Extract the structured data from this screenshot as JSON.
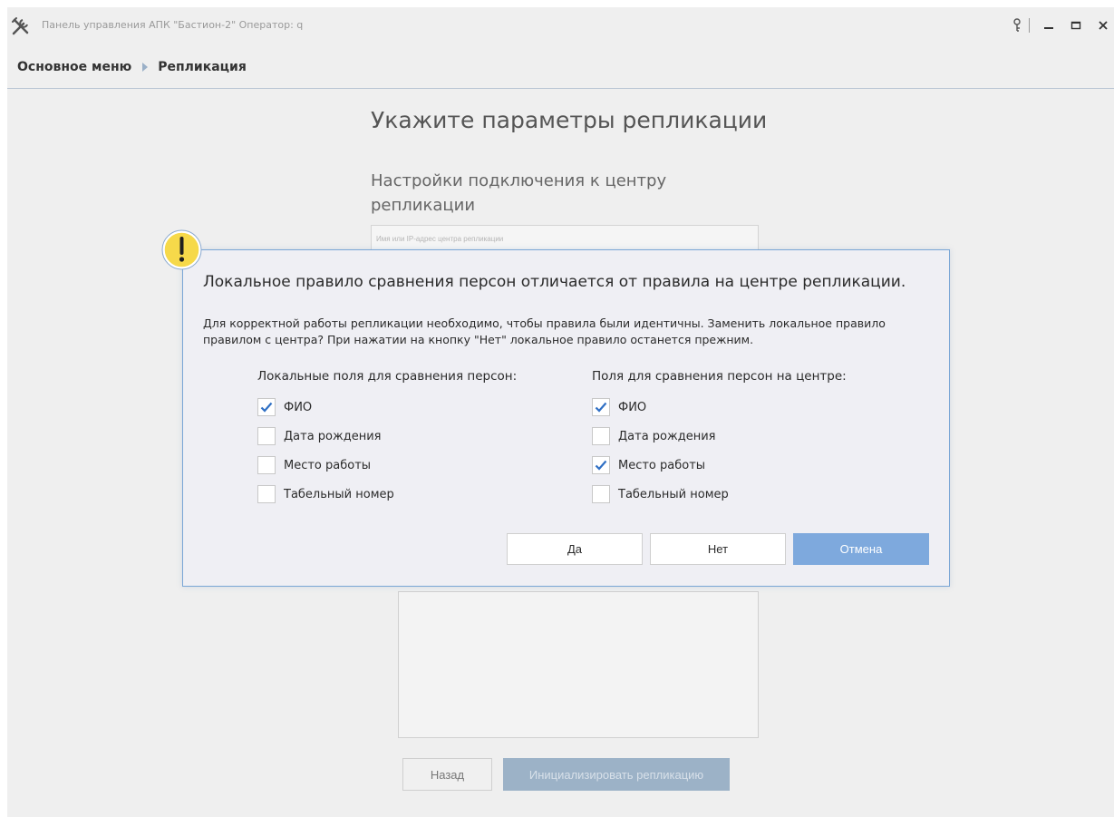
{
  "window": {
    "title": "Панель управления АПК \"Бастион-2\"  Оператор: q",
    "icon": "tools-icon"
  },
  "breadcrumb": {
    "root": "Основное меню",
    "current": "Репликация"
  },
  "page": {
    "title": "Укажите параметры репликации",
    "section_title": "Настройки подключения к центру репликации",
    "server_placeholder": "Имя или IP-адрес центра репликации",
    "back_button": "Назад",
    "init_button": "Инициализировать репликацию"
  },
  "dialog": {
    "icon": "warning-icon",
    "title": "Локальное правило сравнения персон отличается от правила на центре репликации.",
    "message": "Для корректной работы репликации необходимо, чтобы правила были идентичны. Заменить локальное правило правилом с центра? При нажатии на кнопку \"Нет\" локальное правило останется прежним.",
    "local_header": "Локальные поля для сравнения персон:",
    "center_header": "Поля для сравнения персон на центре:",
    "local_fields": [
      {
        "label": "ФИО",
        "checked": true
      },
      {
        "label": "Дата рождения",
        "checked": false
      },
      {
        "label": "Место работы",
        "checked": false
      },
      {
        "label": "Табельный номер",
        "checked": false
      }
    ],
    "center_fields": [
      {
        "label": "ФИО",
        "checked": true
      },
      {
        "label": "Дата рождения",
        "checked": false
      },
      {
        "label": "Место работы",
        "checked": true
      },
      {
        "label": "Табельный номер",
        "checked": false
      }
    ],
    "yes_button": "Да",
    "no_button": "Нет",
    "cancel_button": "Отмена"
  },
  "colors": {
    "accent": "#7ea9dd",
    "checkmark": "#2f6fc4",
    "warning": "#f6d94a"
  }
}
